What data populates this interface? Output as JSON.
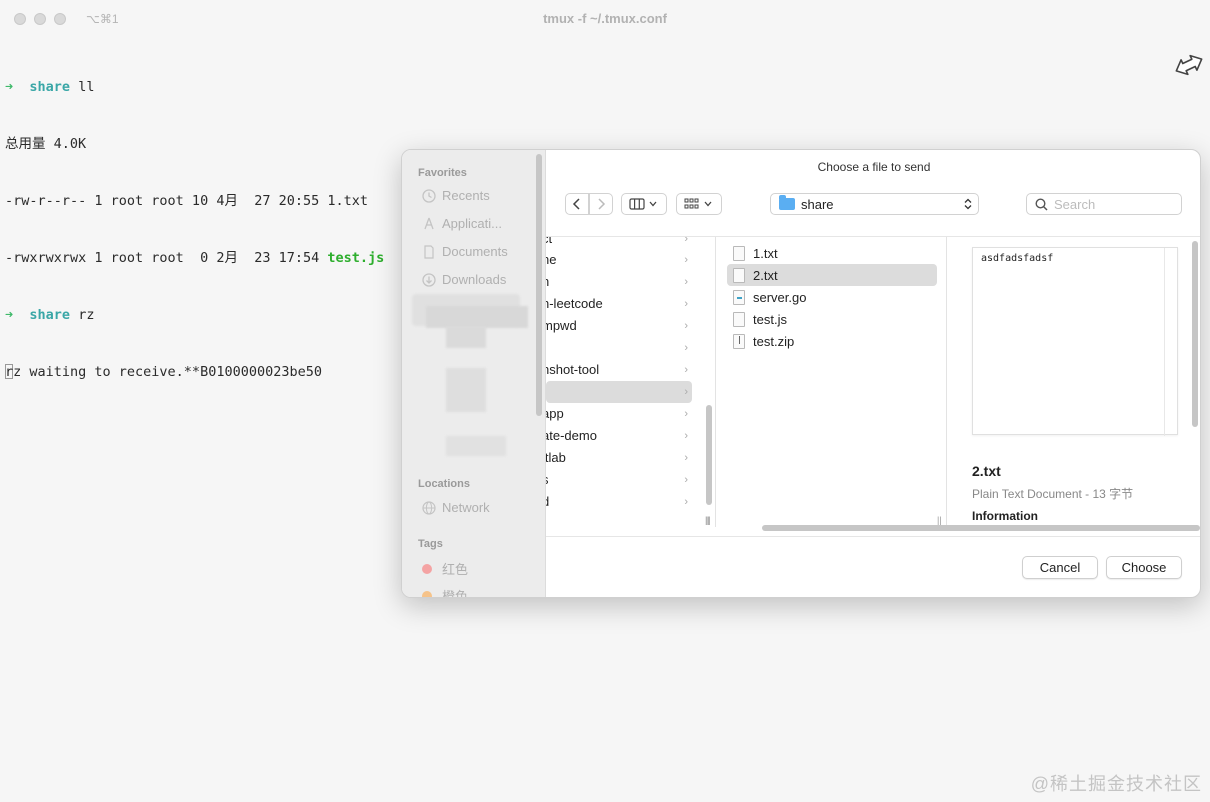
{
  "window": {
    "title": "tmux -f ~/.tmux.conf",
    "shortcut": "⌥⌘1"
  },
  "terminal": {
    "lines": [
      {
        "prompt": "➜",
        "dir": "share",
        "cmd": "ll"
      },
      {
        "text": "总用量 4.0K"
      },
      {
        "text": "-rw-r--r-- 1 root root 10 4月  27 20:55 ",
        "file": "1.txt"
      },
      {
        "text": "-rwxrwxrwx 1 root root  0 2月  23 17:54 ",
        "file": "test.js"
      },
      {
        "prompt": "➜",
        "dir": "share",
        "cmd": "rz"
      },
      {
        "text": "rz waiting to receive.**B0100000023be50"
      }
    ],
    "colors": {
      "prompt": "#3fb96a",
      "dir": "#3aa7a7",
      "exec": "#2dae2d"
    }
  },
  "dialog": {
    "title": "Choose a file to send",
    "sidebar": {
      "favorites_header": "Favorites",
      "favorites": [
        {
          "label": "Recents",
          "icon": "clock-icon"
        },
        {
          "label": "Applicati...",
          "icon": "applications-icon"
        },
        {
          "label": "Documents",
          "icon": "document-icon"
        },
        {
          "label": "Downloads",
          "icon": "download-icon"
        }
      ],
      "locations_header": "Locations",
      "locations": [
        {
          "label": "Network",
          "icon": "globe-icon"
        }
      ],
      "tags_header": "Tags",
      "tags": [
        {
          "label": "红色",
          "color": "#f28b8b"
        },
        {
          "label": "橙色",
          "color": "#f5b971"
        }
      ]
    },
    "toolbar": {
      "back_icon": "chevron-left-icon",
      "forward_icon": "chevron-right-icon",
      "path": "share",
      "search_placeholder": "Search"
    },
    "folders": [
      {
        "label": "ct"
      },
      {
        "label": "ne"
      },
      {
        "label": "n"
      },
      {
        "label": "n-leetcode"
      },
      {
        "label": "mpwd"
      },
      {
        "label": ""
      },
      {
        "label": "nshot-tool"
      },
      {
        "label": "",
        "selected": true
      },
      {
        "label": "app"
      },
      {
        "label": "ate-demo"
      },
      {
        "label": "itlab"
      },
      {
        "label": "s"
      },
      {
        "label": "d"
      }
    ],
    "files": [
      {
        "label": "1.txt",
        "icon": "text-file-icon"
      },
      {
        "label": "2.txt",
        "icon": "text-file-icon",
        "selected": true
      },
      {
        "label": "server.go",
        "icon": "go-file-icon"
      },
      {
        "label": "test.js",
        "icon": "text-file-icon"
      },
      {
        "label": "test.zip",
        "icon": "zip-file-icon"
      }
    ],
    "preview": {
      "content": "asdfadsfadsf",
      "name": "2.txt",
      "kind": "Plain Text Document - 13 字节",
      "info_header": "Information"
    },
    "buttons": {
      "cancel": "Cancel",
      "choose": "Choose"
    }
  },
  "watermark": "@稀土掘金技术社区"
}
